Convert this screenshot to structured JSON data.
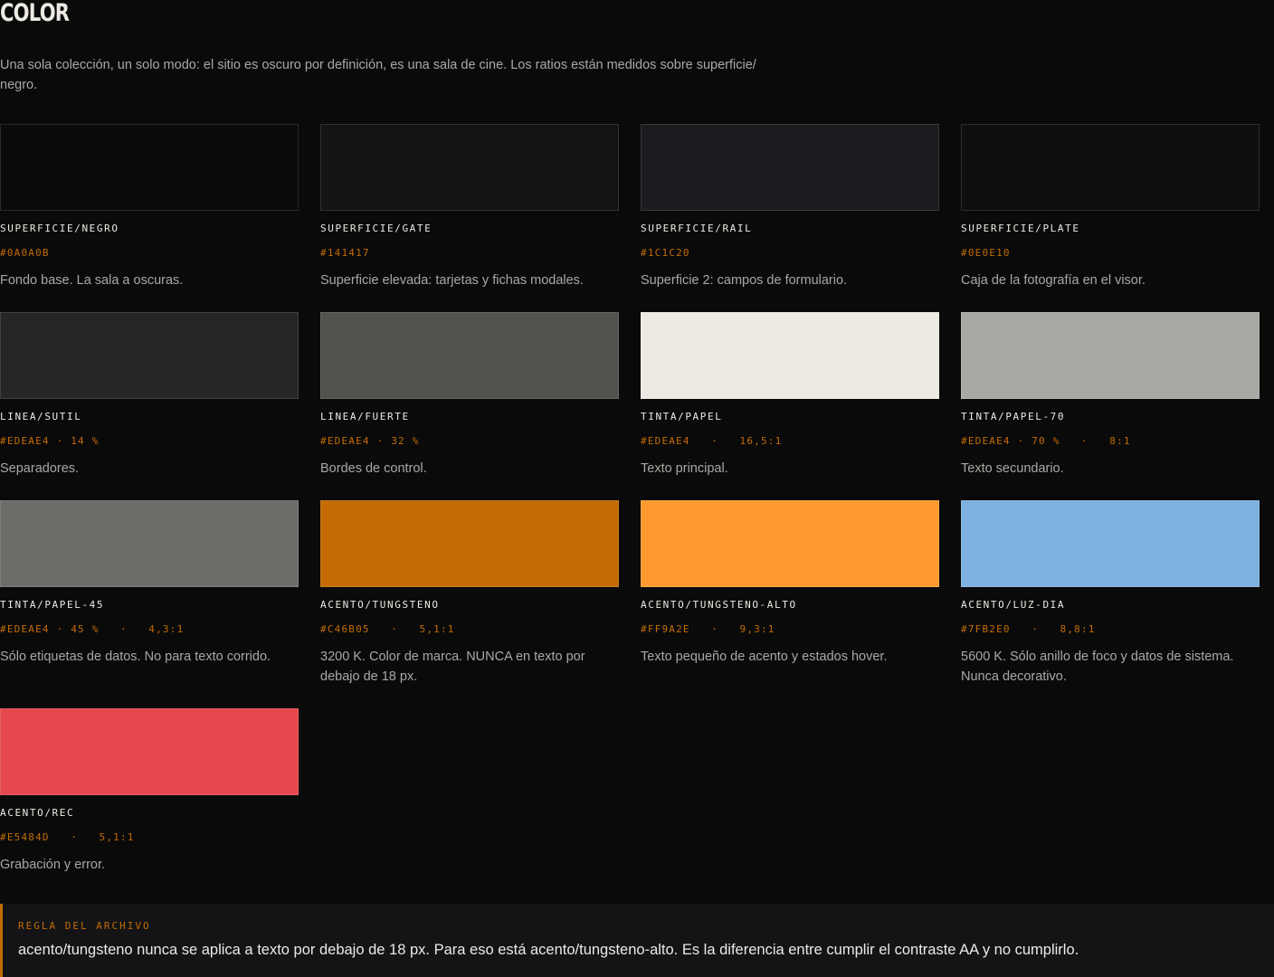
{
  "section": {
    "title": "COLOR",
    "intro": "Una sola colección, un solo modo: el sitio es oscuro por definición, es una sala de cine. Los ratios están medidos sobre superficie/ negro."
  },
  "swatches": [
    {
      "token": "SUPERFICIE/NEGRO",
      "meta": "#0A0A0B",
      "desc": "Fondo base. La sala a oscuras.",
      "color": "#0a0a0b"
    },
    {
      "token": "SUPERFICIE/GATE",
      "meta": "#141417",
      "desc": "Superficie elevada: tarjetas y fichas modales.",
      "color": "#141417"
    },
    {
      "token": "SUPERFICIE/RAIL",
      "meta": "#1C1C20",
      "desc": "Superficie 2: campos de formulario.",
      "color": "#1c1c20"
    },
    {
      "token": "SUPERFICIE/PLATE",
      "meta": "#0E0E10",
      "desc": "Caja de la fotografía en el visor.",
      "color": "#0e0e10"
    },
    {
      "token": "LINEA/SUTIL",
      "meta": "#EDEAE4 · 14 %",
      "desc": "Separadores.",
      "color": "#262626"
    },
    {
      "token": "LINEA/FUERTE",
      "meta": "#EDEAE4 · 32 %",
      "desc": "Bordes de control.",
      "color": "#53524f"
    },
    {
      "token": "TINTA/PAPEL",
      "meta": "#EDEAE4   ·   16,5:1",
      "desc": "Texto principal.",
      "color": "#edeae4"
    },
    {
      "token": "TINTA/PAPEL-70",
      "meta": "#EDEAE4 · 70 %   ·   8:1",
      "desc": "Texto secundario.",
      "color": "#a9a8a4"
    },
    {
      "token": "TINTA/PAPEL-45",
      "meta": "#EDEAE4 · 45 %   ·   4,3:1",
      "desc": "Sólo etiquetas de datos. No para texto corrido.",
      "color": "#6e6d6a"
    },
    {
      "token": "ACENTO/TUNGSTENO",
      "meta": "#C46B05   ·   5,1:1",
      "desc": "3200 K. Color de marca. NUNCA en texto por debajo de 18 px.",
      "color": "#c46b05"
    },
    {
      "token": "ACENTO/TUNGSTENO-ALTO",
      "meta": "#FF9A2E   ·   9,3:1",
      "desc": "Texto pequeño de acento y estados hover.",
      "color": "#ff9a2e"
    },
    {
      "token": "ACENTO/LUZ-DIA",
      "meta": "#7FB2E0   ·   8,8:1",
      "desc": "5600 K. Sólo anillo de foco y datos de sistema. Nunca decorativo.",
      "color": "#7fb2e0"
    },
    {
      "token": "ACENTO/REC",
      "meta": "#E5484D   ·   5,1:1",
      "desc": "Grabación y error.",
      "color": "#e5484d"
    }
  ],
  "rule": {
    "label": "REGLA DEL ARCHIVO",
    "text": "acento/tungsteno nunca se aplica a texto por debajo de 18 px. Para eso está acento/tungsteno-alto. Es la diferencia entre cumplir el contraste AA y no cumplirlo."
  }
}
